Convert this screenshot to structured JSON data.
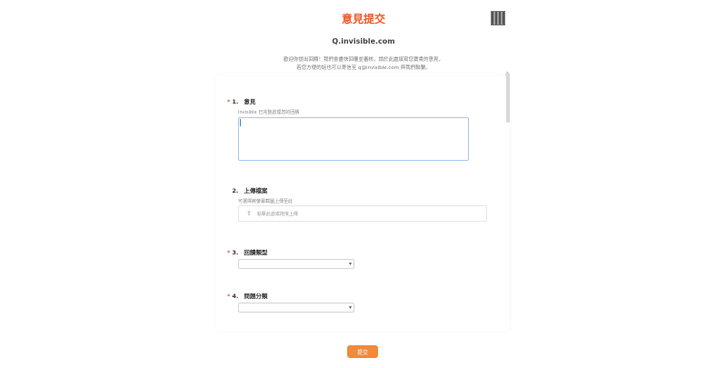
{
  "header": {
    "title": "意見提交",
    "domain": "Q.invisible.com"
  },
  "intro": {
    "line1": "歡迎你提出回饋！我們會盡快回覆並審核，請於此處填寫您寶貴的意見，",
    "line2": "若您方便的話也可以寄信至 q@invisible.com 與我們聯繫。"
  },
  "form": {
    "questions": [
      {
        "number": "1.",
        "required": true,
        "label": "意見",
        "help": "Invisible 已完整處理您的回饋",
        "placeholder": ""
      },
      {
        "number": "2.",
        "required": false,
        "label": "上傳檔案",
        "help": "可選擇將螢幕截圖上傳至此",
        "placeholder": "點擊此處或拖曳上傳"
      },
      {
        "number": "3.",
        "required": true,
        "label": "回饋類型",
        "value": ""
      },
      {
        "number": "4.",
        "required": true,
        "label": "問題分類",
        "value": ""
      }
    ],
    "submit_label": "提交"
  },
  "colors": {
    "accent": "#ef5a2b",
    "button": "#f08a3c",
    "focus_border": "#a8c8ee"
  }
}
